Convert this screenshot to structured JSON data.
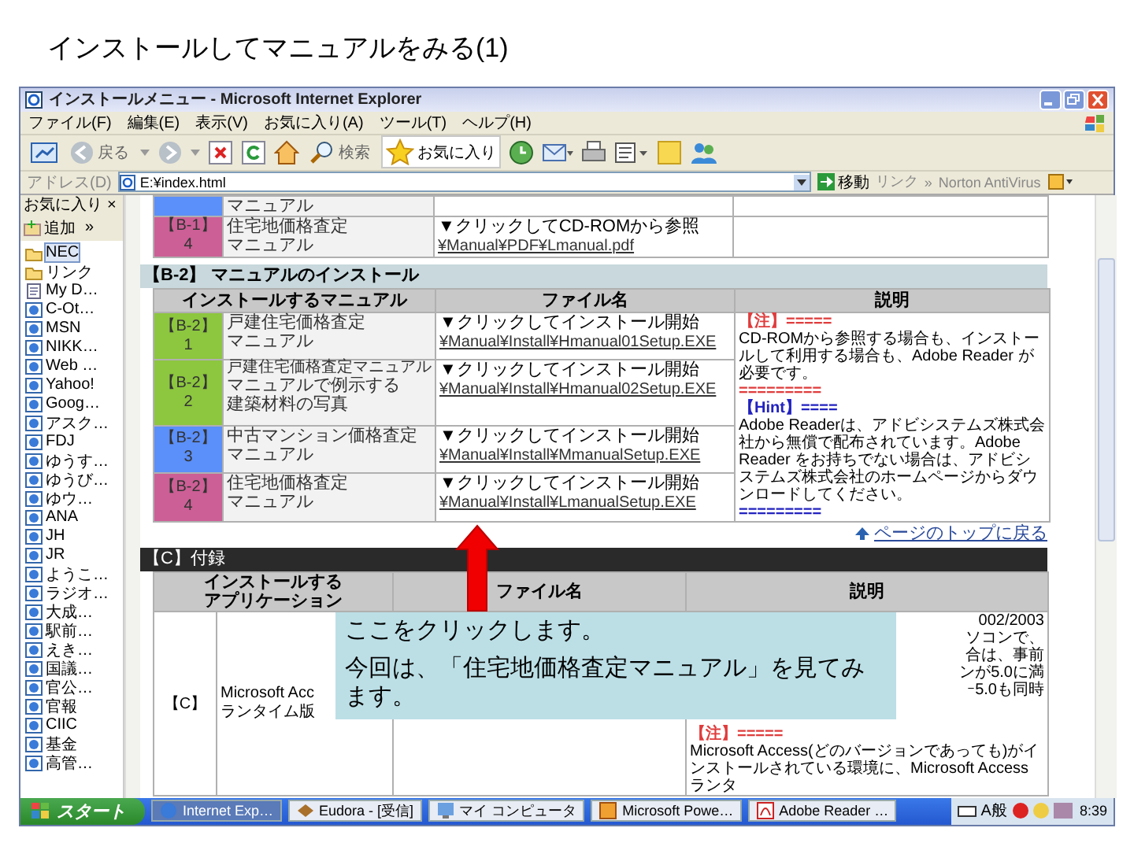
{
  "slide_title": "インストールしてマニュアルをみる(1)",
  "window": {
    "title": "インストールメニュー - Microsoft Internet Explorer"
  },
  "menu": [
    "ファイル(F)",
    "編集(E)",
    "表示(V)",
    "お気に入り(A)",
    "ツール(T)",
    "ヘルプ(H)"
  ],
  "toolbar": {
    "back": "戻る",
    "search": "検索",
    "favorites": "お気に入り"
  },
  "address_bar": {
    "label": "アドレス(D)",
    "value": "E:¥index.html",
    "go": "移動",
    "links": "リンク",
    "links_more": "»",
    "norton": "Norton AntiVirus"
  },
  "favorites_pane": {
    "title": "お気に入り",
    "close": "×",
    "add": "追加",
    "add_more": "»",
    "items": [
      {
        "label": "NEC",
        "kind": "folder",
        "selected": true
      },
      {
        "label": "リンク",
        "kind": "folder",
        "selected": false
      },
      {
        "label": "My D…",
        "kind": "page",
        "selected": false
      },
      {
        "label": "C-Ot…",
        "kind": "link",
        "selected": false
      },
      {
        "label": "MSN",
        "kind": "link",
        "selected": false
      },
      {
        "label": "NIKK…",
        "kind": "link",
        "selected": false
      },
      {
        "label": "Web …",
        "kind": "link",
        "selected": false
      },
      {
        "label": "Yahoo!",
        "kind": "link",
        "selected": false
      },
      {
        "label": "Goog…",
        "kind": "link",
        "selected": false
      },
      {
        "label": "アスク…",
        "kind": "link",
        "selected": false
      },
      {
        "label": "FDJ",
        "kind": "link",
        "selected": false
      },
      {
        "label": "ゆうす…",
        "kind": "link",
        "selected": false
      },
      {
        "label": "ゆうび…",
        "kind": "link",
        "selected": false
      },
      {
        "label": "ゆウ…",
        "kind": "link",
        "selected": false
      },
      {
        "label": "ANA",
        "kind": "link",
        "selected": false
      },
      {
        "label": "JH",
        "kind": "link",
        "selected": false
      },
      {
        "label": "JR",
        "kind": "link",
        "selected": false
      },
      {
        "label": "ようこ…",
        "kind": "link",
        "selected": false
      },
      {
        "label": "ラジオ…",
        "kind": "link",
        "selected": false
      },
      {
        "label": "大成…",
        "kind": "link",
        "selected": false
      },
      {
        "label": "駅前…",
        "kind": "link",
        "selected": false
      },
      {
        "label": "えき…",
        "kind": "link",
        "selected": false
      },
      {
        "label": "国議…",
        "kind": "link",
        "selected": false
      },
      {
        "label": "官公…",
        "kind": "link",
        "selected": false
      },
      {
        "label": "官報",
        "kind": "link",
        "selected": false
      },
      {
        "label": "CIIC",
        "kind": "link",
        "selected": false
      },
      {
        "label": "基金",
        "kind": "link",
        "selected": false
      },
      {
        "label": "高管…",
        "kind": "link",
        "selected": false
      }
    ]
  },
  "page": {
    "b1_rows": [
      {
        "tag": "",
        "number": "",
        "color": "#5b8ff9",
        "name": [
          "マニュアル"
        ],
        "action": "",
        "file": ""
      },
      {
        "tag": "【B-1】",
        "number": "4",
        "color": "#cc5f95",
        "name": [
          "住宅地価格査定",
          "マニュアル"
        ],
        "action": "▼クリックしてCD-ROMから参照",
        "file": "¥Manual¥PDF¥Lmanual.pdf"
      }
    ],
    "b2": {
      "heading": "【B-2】 マニュアルのインストール",
      "columns": [
        "インストールするマニュアル",
        "ファイル名",
        "説明"
      ],
      "rows": [
        {
          "tag": "【B-2】",
          "number": "1",
          "color": "#8dc63f",
          "subtitle": "",
          "name": [
            "戸建住宅価格査定",
            "マニュアル"
          ],
          "action": "▼クリックしてインストール開始",
          "file": "¥Manual¥Install¥Hmanual01Setup.EXE"
        },
        {
          "tag": "【B-2】",
          "number": "2",
          "color": "#8dc63f",
          "subtitle": "戸建住宅価格査定マニュアル",
          "name": [
            "マニュアルで例示する",
            "建築材料の写真"
          ],
          "action": "▼クリックしてインストール開始",
          "file": "¥Manual¥Install¥Hmanual02Setup.EXE"
        },
        {
          "tag": "【B-2】",
          "number": "3",
          "color": "#5b8ff9",
          "subtitle": "",
          "name": [
            "中古マンション価格査定",
            "マニュアル"
          ],
          "action": "▼クリックしてインストール開始",
          "file": "¥Manual¥Install¥MmanualSetup.EXE"
        },
        {
          "tag": "【B-2】",
          "number": "4",
          "color": "#cc5f95",
          "subtitle": "",
          "name": [
            "住宅地価格査定",
            "マニュアル"
          ],
          "action": "▼クリックしてインストール開始",
          "file": "¥Manual¥Install¥LmanualSetup.EXE"
        }
      ],
      "description": [
        {
          "kind": "warn",
          "text": "【注】====="
        },
        {
          "kind": "text",
          "text": "CD-ROMから参照する場合も、インストールして利用する場合も、Adobe Reader が必要です。"
        },
        {
          "kind": "warn",
          "text": "========="
        },
        {
          "kind": "hint",
          "text": "【Hint】===="
        },
        {
          "kind": "text",
          "text": "Adobe Readerは、アドビシステムズ株式会社から無償で配布されています。Adobe Reader をお持ちでない場合は、アドビシステムズ株式会社のホームページからダウンロードしてください。"
        },
        {
          "kind": "hint",
          "text": "========="
        }
      ]
    },
    "top_link": "ページのトップに戻る",
    "c": {
      "heading": "【C】付録",
      "columns": [
        "インストールするアプリケーション",
        "ファイル名",
        "説明"
      ],
      "row": {
        "tag": "【C】",
        "name": [
          "Microsoft Acc",
          "ランタイム版"
        ],
        "description": [
          {
            "kind": "text",
            "text": "002/2003"
          },
          {
            "kind": "text",
            "text": "ソコンで、"
          },
          {
            "kind": "text",
            "text": "合は、事前"
          },
          {
            "kind": "text",
            "text": "ンが5.0に満"
          },
          {
            "kind": "text",
            "text": "ｰ5.0も同時"
          },
          {
            "kind": "warn",
            "text": "【注】====="
          },
          {
            "kind": "text",
            "text": "Microsoft Access(どのバージョンであっても)がインストールされている環境に、Microsoft Access ランタ"
          }
        ]
      }
    }
  },
  "callout": {
    "lines": [
      "ここをクリックします。",
      "今回は、「住宅地価格査定マニュアル」を見てみます。"
    ]
  },
  "taskbar": {
    "start": "スタート",
    "items": [
      {
        "label": "Internet Exp…",
        "selected": true
      },
      {
        "label": "Eudora - [受信]",
        "selected": false
      },
      {
        "label": "マイ コンピュータ",
        "selected": false
      },
      {
        "label": "Microsoft Powe…",
        "selected": false
      },
      {
        "label": "Adobe Reader …",
        "selected": false
      }
    ],
    "ime": "A般",
    "clock": "8:39"
  }
}
